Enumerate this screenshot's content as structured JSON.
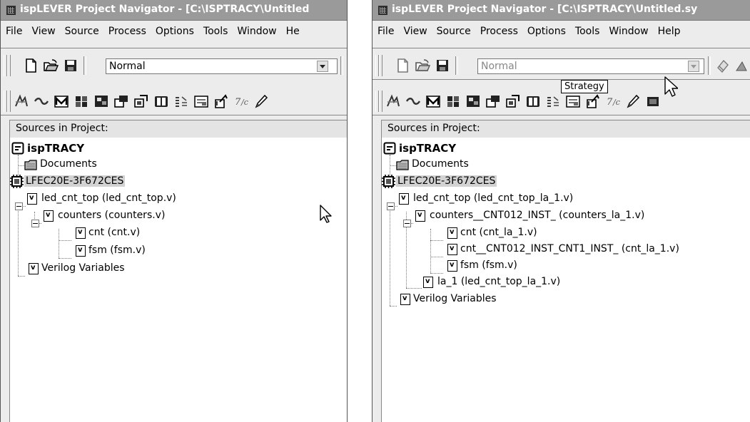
{
  "left_window": {
    "title": "ispLEVER Project Navigator - [C:\\ISPTRACY\\Untitled",
    "menus": [
      "File",
      "View",
      "Source",
      "Process",
      "Options",
      "Tools",
      "Window",
      "He"
    ],
    "strategy_combo": "Normal",
    "panel_header": "Sources in Project:",
    "tree": [
      "ispTRACY",
      "Documents",
      "LFEC20E-3F672CES",
      "led_cnt_top (led_cnt_top.v)",
      "counters (counters.v)",
      "cnt (cnt.v)",
      "fsm (fsm.v)",
      "Verilog Variables"
    ]
  },
  "right_window": {
    "title": "ispLEVER Project Navigator - [C:\\ISPTRACY\\Untitled.sy",
    "menus": [
      "File",
      "View",
      "Source",
      "Process",
      "Options",
      "Tools",
      "Window",
      "Help"
    ],
    "strategy_combo": "Normal",
    "tooltip": "Strategy",
    "panel_header": "Sources in Project:",
    "tree": [
      "ispTRACY",
      "Documents",
      "LFEC20E-3F672CES",
      "led_cnt_top (led_cnt_top_la_1.v)",
      "counters__CNT012_INST_ (counters_la_1.v)",
      "cnt (cnt_la_1.v)",
      "cnt__CNT012_INST_CNT1_INST_ (cnt_la_1.v)",
      "fsm (fsm.v)",
      "la_1 (led_cnt_top_la_1.v)",
      "Verilog Variables"
    ]
  }
}
